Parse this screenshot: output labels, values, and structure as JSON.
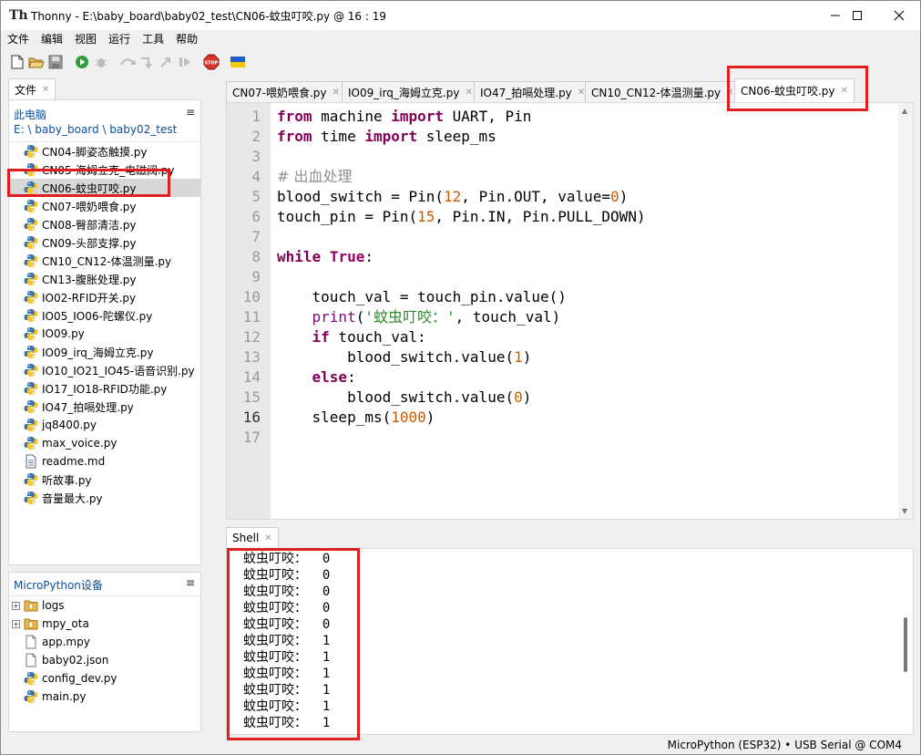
{
  "window": {
    "title": "Thonny  -  E:\\baby_board\\baby02_test\\CN06-蚊虫叮咬.py  @  16 : 19",
    "app_icon_glyph": "Th",
    "controls": [
      "minimize-icon",
      "maximize-icon",
      "close-icon"
    ]
  },
  "menu": [
    "文件",
    "编辑",
    "视图",
    "运行",
    "工具",
    "帮助"
  ],
  "toolbar": {
    "icons": [
      "new-file-icon",
      "open-folder-icon",
      "save-icon",
      "run-icon",
      "debug-icon",
      "step-over-icon",
      "step-into-icon",
      "step-out-icon",
      "resume-icon",
      "stop-icon",
      "ukraine-flag-icon"
    ]
  },
  "files_panel": {
    "tab_label": "文件",
    "local": {
      "title": "此电脑",
      "path": "E: \\ baby_board \\ baby02_test",
      "files": [
        {
          "name": "CN04-脚姿态触摸.py",
          "selected": false
        },
        {
          "name": "CN05-海姆立克_电磁阀.py",
          "selected": false
        },
        {
          "name": "CN06-蚊虫叮咬.py",
          "selected": true
        },
        {
          "name": "CN07-喂奶喂食.py",
          "selected": false
        },
        {
          "name": "CN08-臀部清洁.py",
          "selected": false
        },
        {
          "name": "CN09-头部支撑.py",
          "selected": false
        },
        {
          "name": "CN10_CN12-体温测量.py",
          "selected": false
        },
        {
          "name": "CN13-腹胀处理.py",
          "selected": false
        },
        {
          "name": "IO02-RFID开关.py",
          "selected": false
        },
        {
          "name": "IO05_IO06-陀螺仪.py",
          "selected": false
        },
        {
          "name": "IO09.py",
          "selected": false
        },
        {
          "name": "IO09_irq_海姆立克.py",
          "selected": false
        },
        {
          "name": "IO10_IO21_IO45-语音识别.py",
          "selected": false
        },
        {
          "name": "IO17_IO18-RFID功能.py",
          "selected": false
        },
        {
          "name": "IO47_拍嗝处理.py",
          "selected": false
        },
        {
          "name": "jq8400.py",
          "selected": false
        },
        {
          "name": "max_voice.py",
          "selected": false
        },
        {
          "name": "readme.md",
          "selected": false
        },
        {
          "name": "听故事.py",
          "selected": false
        },
        {
          "name": "音量最大.py",
          "selected": false
        }
      ]
    },
    "device": {
      "title": "MicroPython设备",
      "items": [
        {
          "name": "logs",
          "type": "folder"
        },
        {
          "name": "mpy_ota",
          "type": "folder"
        },
        {
          "name": "app.mpy",
          "type": "file"
        },
        {
          "name": "baby02.json",
          "type": "file"
        },
        {
          "name": "config_dev.py",
          "type": "python"
        },
        {
          "name": "main.py",
          "type": "python"
        }
      ]
    }
  },
  "editor": {
    "tabs": [
      {
        "label": "CN07-喂奶喂食.py",
        "active": false
      },
      {
        "label": "IO09_irq_海姆立克.py",
        "active": false
      },
      {
        "label": "IO47_拍嗝处理.py",
        "active": false
      },
      {
        "label": "CN10_CN12-体温测量.py",
        "active": false
      },
      {
        "label": "CN06-蚊虫叮咬.py",
        "active": true
      }
    ],
    "current_line": 16,
    "line_numbers": [
      "1",
      "2",
      "3",
      "4",
      "5",
      "6",
      "7",
      "8",
      "9",
      "10",
      "11",
      "12",
      "13",
      "14",
      "15",
      "16",
      "17"
    ],
    "code": [
      "from machine import UART, Pin",
      "from time import sleep_ms",
      "",
      "# 出血处理",
      "blood_switch = Pin(12, Pin.OUT, value=0)",
      "touch_pin = Pin(15, Pin.IN, Pin.PULL_DOWN)",
      "",
      "while True:",
      "",
      "    touch_val = touch_pin.value()",
      "    print('蚊虫叮咬：', touch_val)",
      "    if touch_val:",
      "        blood_switch.value(1)",
      "    else:",
      "        blood_switch.value(0)",
      "    sleep_ms(1000)",
      ""
    ]
  },
  "shell": {
    "tab_label": "Shell",
    "lines": [
      "蚊虫叮咬：  0",
      "蚊虫叮咬：  0",
      "蚊虫叮咬：  0",
      "蚊虫叮咬：  0",
      "蚊虫叮咬：  0",
      "蚊虫叮咬：  1",
      "蚊虫叮咬：  1",
      "蚊虫叮咬：  1",
      "蚊虫叮咬：  1",
      "蚊虫叮咬：  1",
      "蚊虫叮咬：  1"
    ]
  },
  "status": {
    "interpreter": "MicroPython (ESP32)  •  USB Serial @ COM4"
  },
  "colors": {
    "highlight_box": "#e02020",
    "keyword": "#7f0055",
    "number": "#c85a00",
    "string": "#2a8a2a",
    "comment": "#909090",
    "folder_link": "#0a50a0"
  }
}
